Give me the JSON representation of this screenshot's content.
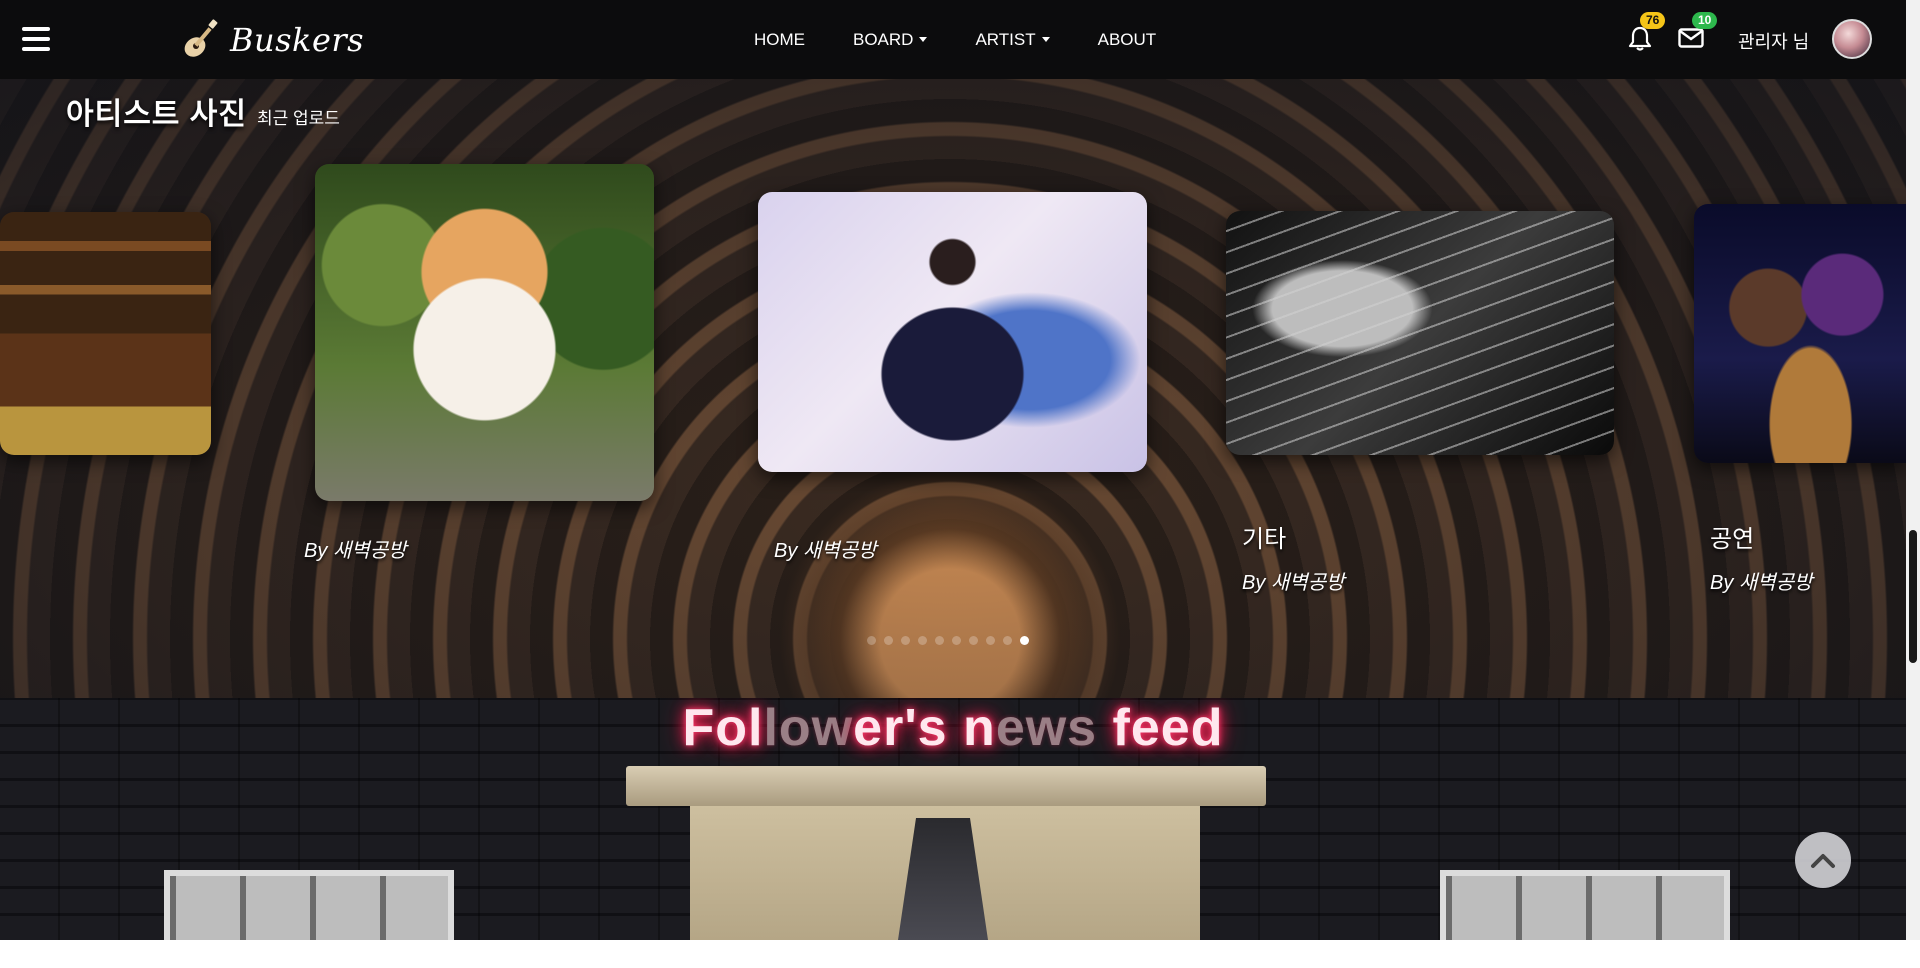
{
  "navbar": {
    "brand": "Buskers",
    "menu": [
      {
        "label": "HOME",
        "dropdown": false
      },
      {
        "label": "BOARD",
        "dropdown": true
      },
      {
        "label": "ARTIST",
        "dropdown": true
      },
      {
        "label": "ABOUT",
        "dropdown": false
      }
    ],
    "notifications_count": "76",
    "messages_count": "10",
    "user_label": "관리자 님",
    "colors": {
      "notif_badge": "#f5c518",
      "msg_badge": "#2db84c",
      "navbar_bg": "#0c0c0d"
    }
  },
  "gallery": {
    "title": "아티스트 사진",
    "subtitle": "최근 업로드",
    "slides": [
      {
        "image": "library-room-photo",
        "title": "",
        "by": ""
      },
      {
        "image": "pomeranian-dog-photo",
        "title": "",
        "by": "By 새벽공방"
      },
      {
        "image": "singer-portrait-photo",
        "title": "",
        "by": "By 새벽공방"
      },
      {
        "image": "guitar-closeup-photo",
        "title": "기타",
        "by": "By 새벽공방"
      },
      {
        "image": "concert-performance-photo",
        "title": "공연",
        "by": "By 새벽공방"
      }
    ],
    "dots_total": 10,
    "active_dot": 9
  },
  "feed": {
    "title_parts": [
      {
        "text": "Fol",
        "dim": false
      },
      {
        "text": "low",
        "dim": true
      },
      {
        "text": "er's ",
        "dim": false
      },
      {
        "text": "n",
        "dim": false
      },
      {
        "text": "ews",
        "dim": true
      },
      {
        "text": " feed",
        "dim": false
      }
    ]
  },
  "scroll_top_icon": "chevron-up-icon"
}
